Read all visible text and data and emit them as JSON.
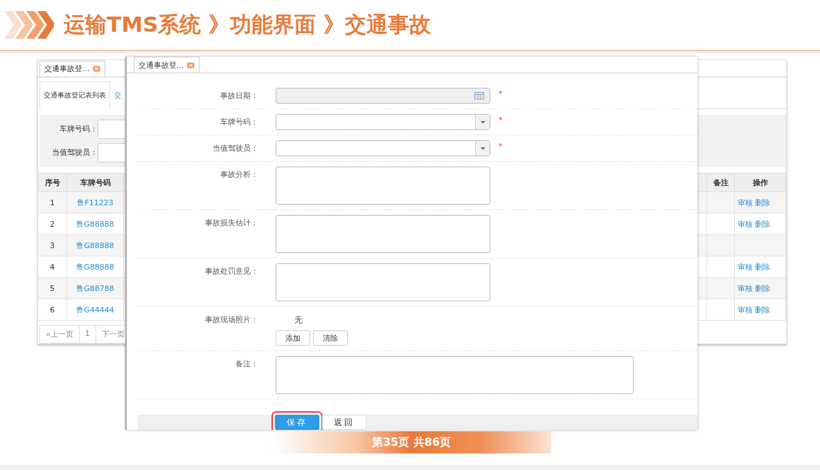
{
  "slide": {
    "title": "运输TMS系统 》功能界面 》交通事故",
    "page": "第35页 共86页"
  },
  "list_window": {
    "tab": {
      "label": "交通事故登...",
      "selected": true
    },
    "subtabs": [
      {
        "label": "交通事故登记表列表",
        "selected": true
      },
      {
        "label": "交",
        "selected": false
      }
    ],
    "filters": [
      {
        "label": "车牌号码："
      },
      {
        "label": "当值驾驶员："
      }
    ],
    "table": {
      "columns": [
        "序号",
        "车牌号码",
        "备注",
        "操作"
      ],
      "rows": [
        {
          "index": "1",
          "plate": "鲁F11223",
          "actions": [
            "审核",
            "删除"
          ]
        },
        {
          "index": "2",
          "plate": "鲁G88888",
          "actions": [
            "审核",
            "删除"
          ]
        },
        {
          "index": "3",
          "plate": "鲁G88888"
        },
        {
          "index": "4",
          "plate": "鲁G88888",
          "actions": [
            "审核",
            "删除"
          ]
        },
        {
          "index": "5",
          "plate": "鲁G88788",
          "actions": [
            "审核",
            "删除"
          ]
        },
        {
          "index": "6",
          "plate": "鲁G44444",
          "actions": [
            "审核",
            "删除"
          ]
        }
      ]
    },
    "pagination": [
      "«上一页",
      "1",
      "下一页"
    ]
  },
  "dialog": {
    "tab": {
      "label": "交通事故登...",
      "selected": true
    },
    "fields": [
      {
        "kind": "date",
        "label": "事故日期：",
        "disabled": true,
        "required_mark": "*"
      },
      {
        "kind": "select",
        "label": "车牌号码：",
        "disabled": false,
        "required_mark": "*"
      },
      {
        "kind": "select",
        "label": "当值驾驶员：",
        "disabled": false,
        "required_mark": "*"
      },
      {
        "kind": "textarea",
        "label": "事故分析：",
        "wide": false
      },
      {
        "kind": "textarea",
        "label": "事故损失估计：",
        "wide": false
      },
      {
        "kind": "textarea",
        "label": "事故处罚意见：",
        "wide": false
      },
      {
        "kind": "photo",
        "label": "事故现场照片：",
        "value": "无",
        "buttons": [
          "添加",
          "清除"
        ]
      },
      {
        "kind": "textarea",
        "label": "备注：",
        "wide": true
      }
    ],
    "buttons": [
      {
        "label": "保存",
        "kind": "primary",
        "focused": true
      },
      {
        "label": "返回",
        "kind": "default",
        "focused": false
      }
    ]
  }
}
